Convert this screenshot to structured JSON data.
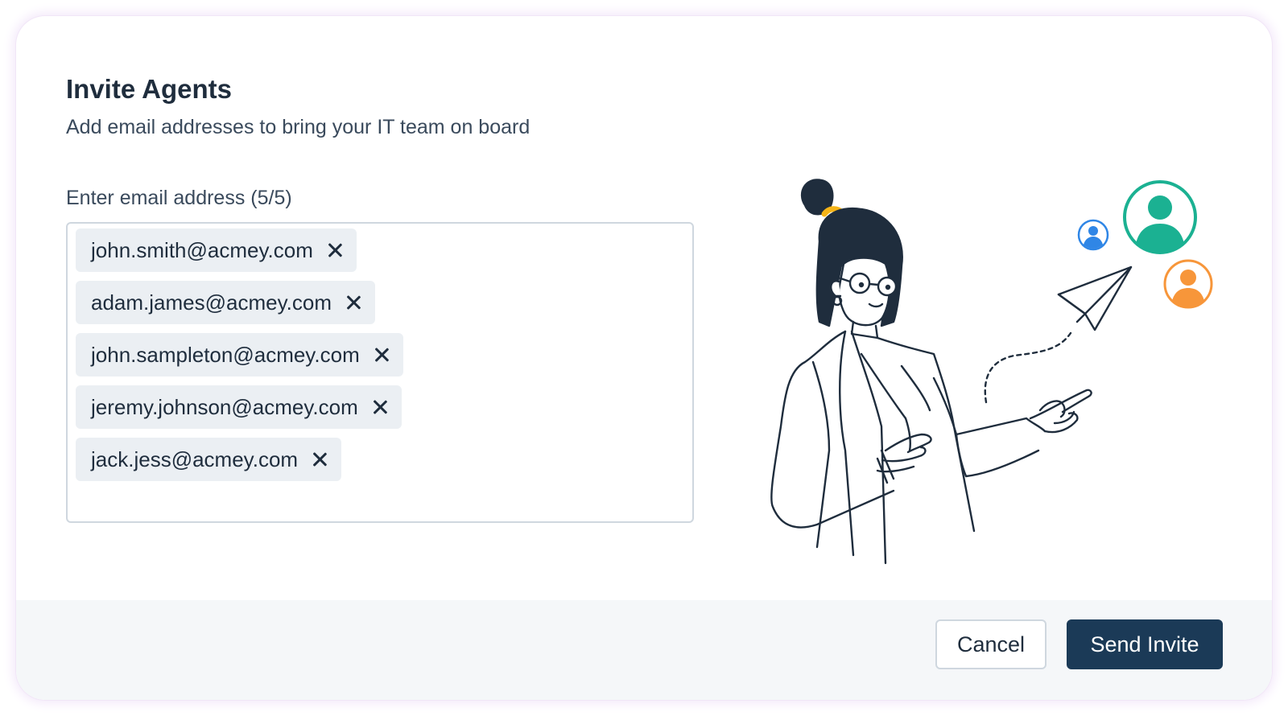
{
  "dialog": {
    "title": "Invite Agents",
    "subtitle": "Add email addresses to bring your IT team on board"
  },
  "email_field": {
    "label": "Enter email address (5/5)",
    "emails": [
      "john.smith@acmey.com",
      "adam.james@acmey.com",
      "john.sampleton@acmey.com",
      "jeremy.johnson@acmey.com",
      "jack.jess@acmey.com"
    ]
  },
  "footer": {
    "cancel_label": "Cancel",
    "send_label": "Send Invite"
  },
  "colors": {
    "primary": "#1b3a57",
    "avatar_green": "#1bb192",
    "avatar_blue": "#2f86e6",
    "avatar_orange": "#f7963a",
    "hair_tie": "#f5b417"
  },
  "icons": {
    "remove_chip": "close-icon",
    "illustration": "woman-pointing-illustration",
    "paper_plane": "paper-plane-icon",
    "avatars": [
      "user-avatar-icon",
      "user-avatar-icon",
      "user-avatar-icon"
    ]
  }
}
